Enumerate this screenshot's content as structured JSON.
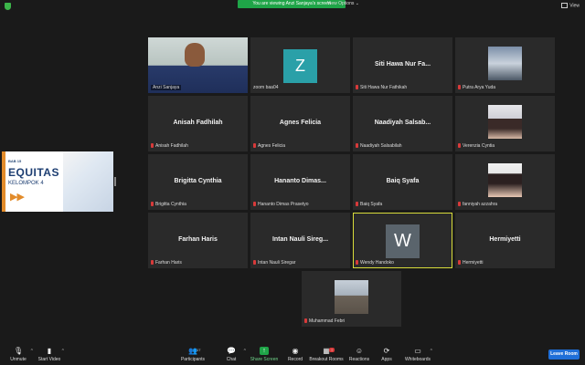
{
  "topbar": {
    "viewing_banner": "You are viewing Anzi Sanjaya's screen",
    "view_options": "View Options",
    "view_button": "View"
  },
  "share": {
    "bab": "BAB 15",
    "title": "EQUITAS",
    "subtitle": "KELOMPOK 4"
  },
  "tiles": [
    {
      "label": "Anzi Sanjaya"
    },
    {
      "label": "zoom baa04",
      "letter": "Z"
    },
    {
      "big": "Siti Hawa Nur Fa...",
      "label": "Siti Hawa Nur Fathikah"
    },
    {
      "label": "Putra Arya Yuda"
    },
    {
      "big": "Anisah Fadhilah",
      "label": "Anisah Fadhilah"
    },
    {
      "big": "Agnes Felicia",
      "label": "Agnes Felicia"
    },
    {
      "big": "Naadiyah Salsab...",
      "label": "Naadiyah Salsabilah"
    },
    {
      "label": "Verenzia Cyntia"
    },
    {
      "big": "Brigitta Cynthia",
      "label": "Brigitta Cynthia"
    },
    {
      "big": "Hananto Dimas...",
      "label": "Hananto Dimas Prasetyo"
    },
    {
      "big": "Baiq Syafa",
      "label": "Baiq Syafa"
    },
    {
      "label": "fanniyah azzahra"
    },
    {
      "big": "Farhan Haris",
      "label": "Farhan Haris"
    },
    {
      "big": "Intan Nauli Sireg...",
      "label": "Intan Nauli Siregar"
    },
    {
      "label": "Wendy Handoko",
      "letter": "W"
    },
    {
      "big": "Hermiyetti",
      "label": "Hermiyetti"
    },
    {
      "label": "Muhammad Febri"
    }
  ],
  "toolbar": {
    "unmute": "Unmute",
    "start_video": "Start Video",
    "participants": "Participants",
    "participants_count": "17",
    "chat": "Chat",
    "share_screen": "Share Screen",
    "record": "Record",
    "breakout": "Breakout Rooms",
    "breakout_badge": "!",
    "reactions": "Reactions",
    "apps": "Apps",
    "whiteboards": "Whiteboards",
    "leave": "Leave Room"
  }
}
